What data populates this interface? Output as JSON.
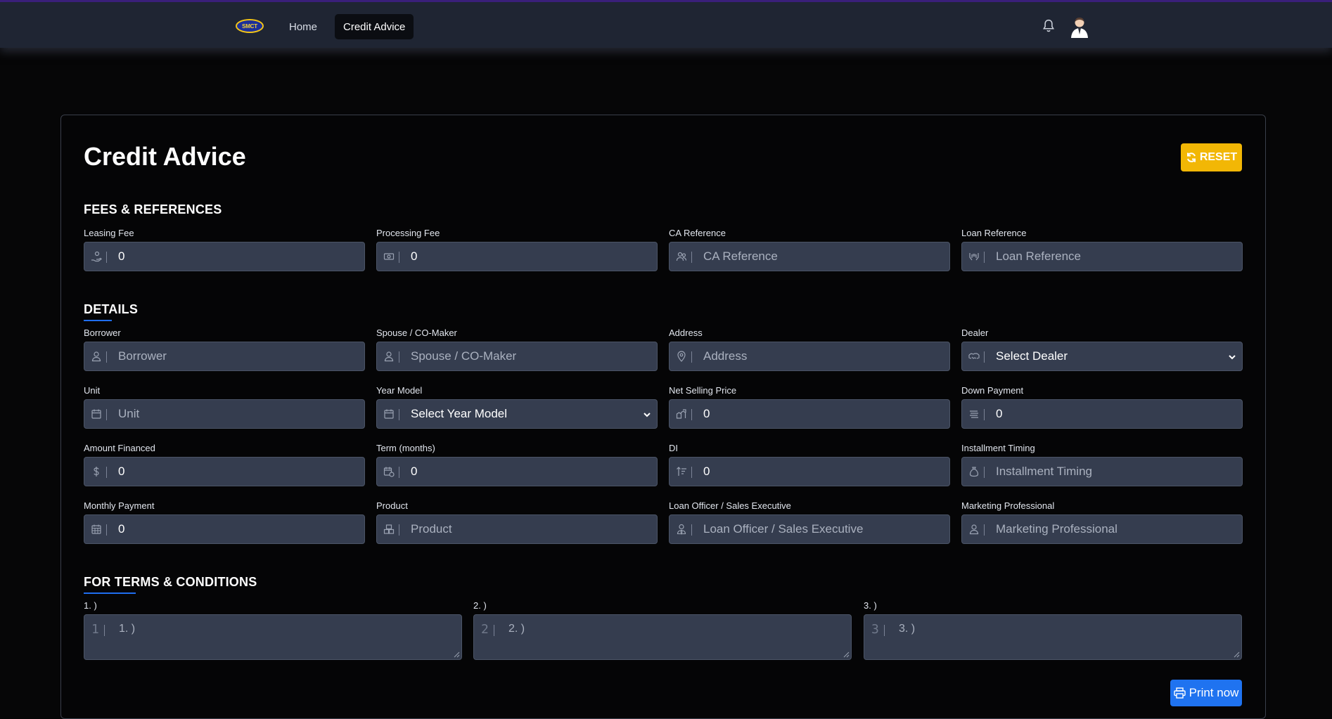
{
  "nav": {
    "logo_text": "SMCT",
    "home": "Home",
    "credit_advice": "Credit Advice",
    "bell_icon": "bell-icon",
    "avatar_icon": "user-avatar-icon"
  },
  "page": {
    "title": "Credit Advice",
    "reset_label": "RESET"
  },
  "fees": {
    "section_title": "FEES & REFERENCES",
    "leasing_fee": {
      "label": "Leasing Fee",
      "value": "0",
      "icon": "hand-coin-icon"
    },
    "processing_fee": {
      "label": "Processing Fee",
      "value": "0",
      "icon": "money-bill-icon"
    },
    "ca_reference": {
      "label": "CA Reference",
      "placeholder": "CA Reference",
      "icon": "people-icon"
    },
    "loan_reference": {
      "label": "Loan Reference",
      "placeholder": "Loan Reference",
      "icon": "hands-icon"
    }
  },
  "details": {
    "section_title": "DETAILS",
    "borrower": {
      "label": "Borrower",
      "placeholder": "Borrower"
    },
    "spouse": {
      "label": "Spouse / CO-Maker",
      "placeholder": "Spouse / CO-Maker"
    },
    "address": {
      "label": "Address",
      "placeholder": "Address"
    },
    "dealer": {
      "label": "Dealer",
      "selected": "Select Dealer"
    },
    "unit": {
      "label": "Unit",
      "placeholder": "Unit"
    },
    "year_model": {
      "label": "Year Model",
      "selected": "Select Year Model"
    },
    "net_selling_price": {
      "label": "Net Selling Price",
      "value": "0"
    },
    "down_payment": {
      "label": "Down Payment",
      "value": "0"
    },
    "amount_financed": {
      "label": "Amount Financed",
      "value": "0"
    },
    "term": {
      "label": "Term (months)",
      "value": "0"
    },
    "di": {
      "label": "DI",
      "value": "0"
    },
    "installment_timing": {
      "label": "Installment Timing",
      "placeholder": "Installment Timing"
    },
    "monthly_payment": {
      "label": "Monthly Payment",
      "value": "0"
    },
    "product": {
      "label": "Product",
      "placeholder": "Product"
    },
    "loan_officer": {
      "label": "Loan Officer / Sales Executive",
      "placeholder": "Loan Officer / Sales Executive"
    },
    "marketing": {
      "label": "Marketing Professional",
      "placeholder": "Marketing Professional"
    }
  },
  "terms": {
    "section_title": "FOR TERMS & CONDITIONS",
    "items": [
      {
        "label": "1. )",
        "num": "1",
        "placeholder": "1. )"
      },
      {
        "label": "2. )",
        "num": "2",
        "placeholder": "2. )"
      },
      {
        "label": "3. )",
        "num": "3",
        "placeholder": "3. )"
      }
    ]
  },
  "actions": {
    "print_label": "Print now"
  },
  "colors": {
    "reset": "#f2b705",
    "print": "#1f73f0",
    "field_bg": "#353d4f",
    "nav_bg": "#1f2533"
  }
}
